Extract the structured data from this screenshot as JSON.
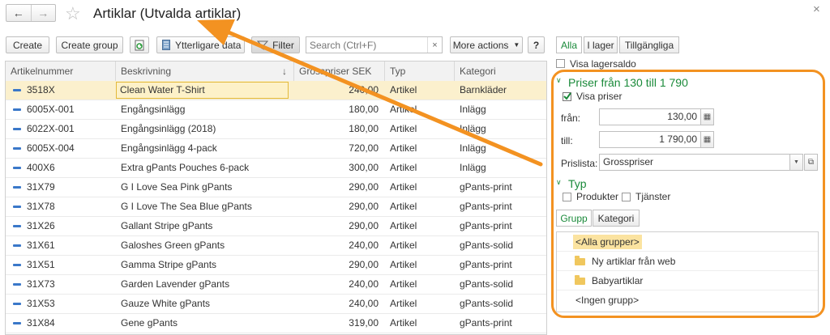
{
  "header": {
    "title": "Artiklar (Utvalda artiklar)",
    "back": "←",
    "forward": "→",
    "star": "☆",
    "close": "×"
  },
  "toolbar": {
    "create": "Create",
    "create_group": "Create group",
    "more_data": "Ytterligare data",
    "filter": "Filter",
    "search_placeholder": "Search (Ctrl+F)",
    "search_clear": "×",
    "more_actions": "More actions",
    "help": "?"
  },
  "table": {
    "columns": [
      "Artikelnummer",
      "Beskrivning",
      "Grosspriser SEK",
      "Typ",
      "Kategori"
    ],
    "sort_indicator": "↓",
    "rows": [
      {
        "nr": "3518X",
        "desc": "Clean Water T-Shirt",
        "price": "240,00",
        "typ": "Artikel",
        "kat": "Barnkläder"
      },
      {
        "nr": "6005X-001",
        "desc": "Engångsinlägg",
        "price": "180,00",
        "typ": "Artikel",
        "kat": "Inlägg"
      },
      {
        "nr": "6022X-001",
        "desc": "Engångsinlägg (2018)",
        "price": "180,00",
        "typ": "Artikel",
        "kat": "Inlägg"
      },
      {
        "nr": "6005X-004",
        "desc": "Engångsinlägg 4-pack",
        "price": "720,00",
        "typ": "Artikel",
        "kat": "Inlägg"
      },
      {
        "nr": "400X6",
        "desc": "Extra gPants Pouches 6-pack",
        "price": "300,00",
        "typ": "Artikel",
        "kat": "Inlägg"
      },
      {
        "nr": "31X79",
        "desc": "G I Love Sea Pink gPants",
        "price": "290,00",
        "typ": "Artikel",
        "kat": "gPants-print"
      },
      {
        "nr": "31X78",
        "desc": "G I Love The Sea Blue gPants",
        "price": "290,00",
        "typ": "Artikel",
        "kat": "gPants-print"
      },
      {
        "nr": "31X26",
        "desc": "Gallant Stripe gPants",
        "price": "290,00",
        "typ": "Artikel",
        "kat": "gPants-print"
      },
      {
        "nr": "31X61",
        "desc": "Galoshes Green gPants",
        "price": "240,00",
        "typ": "Artikel",
        "kat": "gPants-solid"
      },
      {
        "nr": "31X51",
        "desc": "Gamma Stripe gPants",
        "price": "290,00",
        "typ": "Artikel",
        "kat": "gPants-print"
      },
      {
        "nr": "31X73",
        "desc": "Garden Lavender gPants",
        "price": "240,00",
        "typ": "Artikel",
        "kat": "gPants-solid"
      },
      {
        "nr": "31X53",
        "desc": "Gauze White gPants",
        "price": "240,00",
        "typ": "Artikel",
        "kat": "gPants-solid"
      },
      {
        "nr": "31X84",
        "desc": "Gene gPants",
        "price": "319,00",
        "typ": "Artikel",
        "kat": "gPants-print"
      }
    ]
  },
  "stock_tabs": [
    "Alla",
    "I lager",
    "Tillgängliga"
  ],
  "show_stock_label": "Visa lagersaldo",
  "price_section": {
    "title": "Priser från 130 till 1 790",
    "show_prices_label": "Visa priser",
    "from_label": "från:",
    "from_value": "130,00",
    "to_label": "till:",
    "to_value": "1 790,00",
    "pricelist_label": "Prislista:",
    "pricelist_value": "Grosspriser"
  },
  "type_section": {
    "title": "Typ",
    "products_label": "Produkter",
    "services_label": "Tjänster"
  },
  "group_tabs": [
    "Grupp",
    "Kategori"
  ],
  "groups": [
    "<Alla grupper>",
    "Ny artiklar från web",
    "Babyartiklar",
    "<Ingen grupp>"
  ],
  "colors": {
    "accent_green": "#1a8a3a",
    "highlight_orange": "#f39221",
    "selected_row": "#fbf0cd"
  }
}
